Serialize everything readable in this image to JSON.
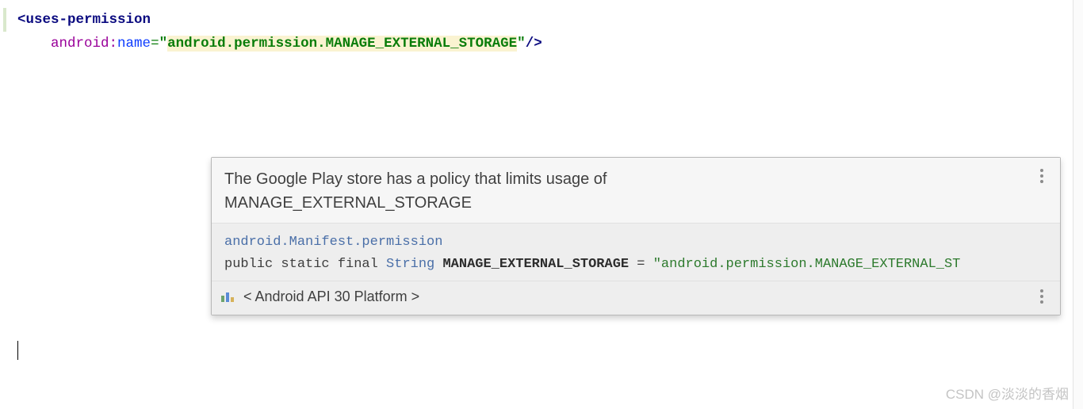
{
  "code": {
    "l1_open": "<",
    "l1_tag": "uses-permission",
    "l2_indent": "    ",
    "l2_ns": "android",
    "l2_colon": ":",
    "l2_attr": "name",
    "l2_eq": "=",
    "l2_q": "\"",
    "l2_val": "android.permission.MANAGE_EXTERNAL_STORAGE",
    "l2_close": "/>"
  },
  "tooltip": {
    "warning_line1": "The Google Play store has a policy that limits usage of",
    "warning_line2": "MANAGE_EXTERNAL_STORAGE",
    "doc_class": "android.Manifest.permission",
    "doc_mods": "public static final ",
    "doc_type": "String",
    "doc_field": " MANAGE_EXTERNAL_STORAGE",
    "doc_assign": " = ",
    "doc_value": "\"android.permission.MANAGE_EXTERNAL_ST",
    "source_label": "< Android API 30 Platform >"
  },
  "watermark": "CSDN @淡淡的香烟"
}
